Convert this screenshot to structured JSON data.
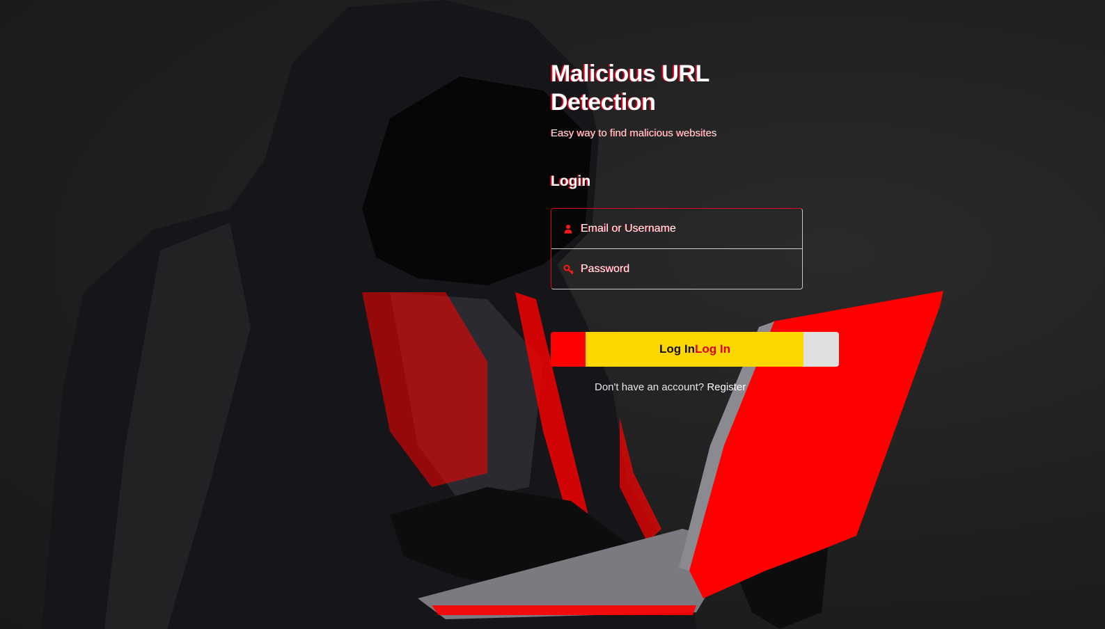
{
  "app": {
    "title": "Malicious URL Detection",
    "subtitle": "Easy way to find malicious websites"
  },
  "login": {
    "heading": "Login",
    "username_placeholder": "Email or Username",
    "password_placeholder": "Password",
    "submit_label": "Log In",
    "register_prompt": "Don't have an account?",
    "register_link": "Register"
  },
  "icons": {
    "username": "user-icon",
    "password": "key-icon"
  },
  "colors": {
    "background": "#232223",
    "accent_red": "#ff0000",
    "button_yellow": "#ffd700",
    "button_grey": "#e0e0e0",
    "text": "#ffffff"
  }
}
